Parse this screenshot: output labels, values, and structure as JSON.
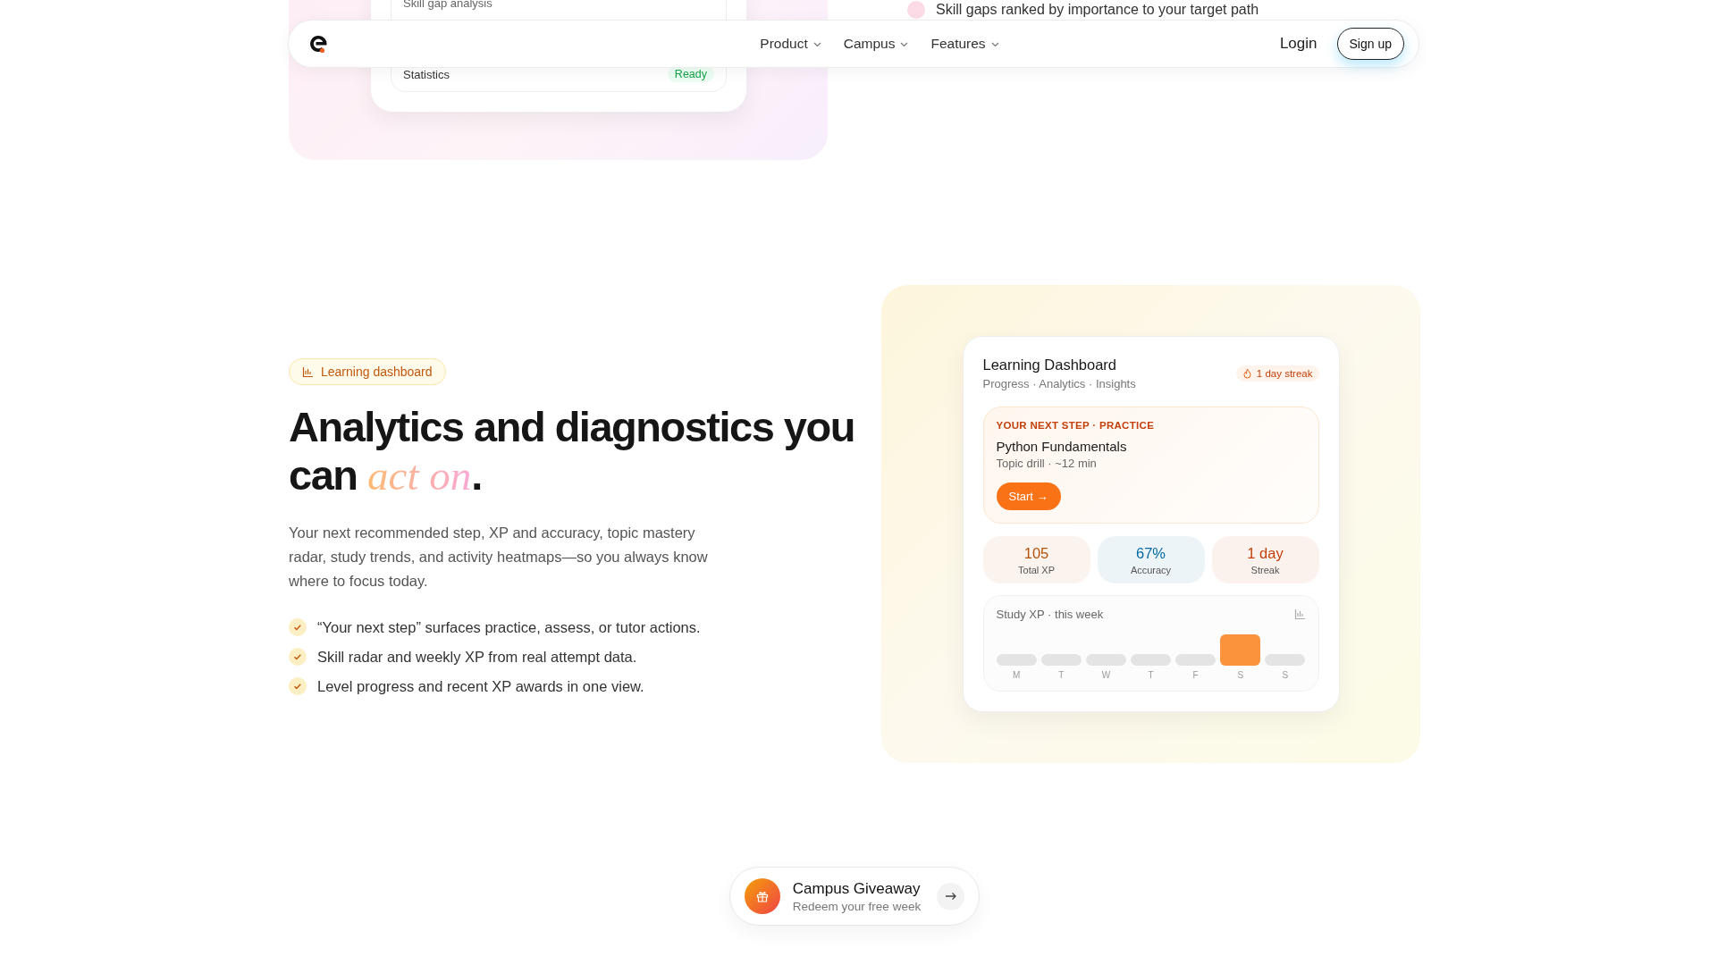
{
  "nav": {
    "menu": [
      {
        "label": "Product",
        "has_dropdown": true
      },
      {
        "label": "Campus",
        "has_dropdown": true
      },
      {
        "label": "Features",
        "has_dropdown": true
      }
    ],
    "login": "Login",
    "signup": "Sign up"
  },
  "previous_section": {
    "card": {
      "title": "Skill gap analysis",
      "row_label": "Statistics",
      "row_status": "Ready"
    },
    "point": "Skill gaps ranked by importance to your target path"
  },
  "feature": {
    "badge": "Learning dashboard",
    "heading_start": "Analytics and diagnostics you can ",
    "heading_accent": "act on",
    "heading_end": ".",
    "description": "Your next recommended step, XP and accuracy, topic mastery radar, study trends, and activity heatmaps—so you always know where to focus today.",
    "bullets": [
      "“Your next step” surfaces practice, assess, or tutor actions.",
      "Skill radar and weekly XP from real attempt data.",
      "Level progress and recent XP awards in one view."
    ]
  },
  "dashboard": {
    "title": "Learning Dashboard",
    "subtitle": "Progress · Analytics · Insights",
    "streak_badge": "1 day streak",
    "next_step": {
      "label": "YOUR NEXT STEP · PRACTICE",
      "title": "Python Fundamentals",
      "meta": "Topic drill · ~12 min",
      "button": "Start →"
    },
    "stats": [
      {
        "value": "105",
        "label": "Total XP",
        "color": "#b45309"
      },
      {
        "value": "67%",
        "label": "Accuracy",
        "color": "#0369a1"
      },
      {
        "value": "1 day",
        "label": "Streak",
        "color": "#c2410c"
      }
    ],
    "chart_title": "Study XP · this week",
    "days": [
      {
        "label": "M",
        "active": false
      },
      {
        "label": "T",
        "active": false
      },
      {
        "label": "W",
        "active": false
      },
      {
        "label": "T",
        "active": false
      },
      {
        "label": "F",
        "active": false
      },
      {
        "label": "S",
        "active": true
      },
      {
        "label": "S",
        "active": false
      }
    ]
  },
  "promo": {
    "title": "Campus Giveaway",
    "subtitle": "Redeem your free week"
  }
}
